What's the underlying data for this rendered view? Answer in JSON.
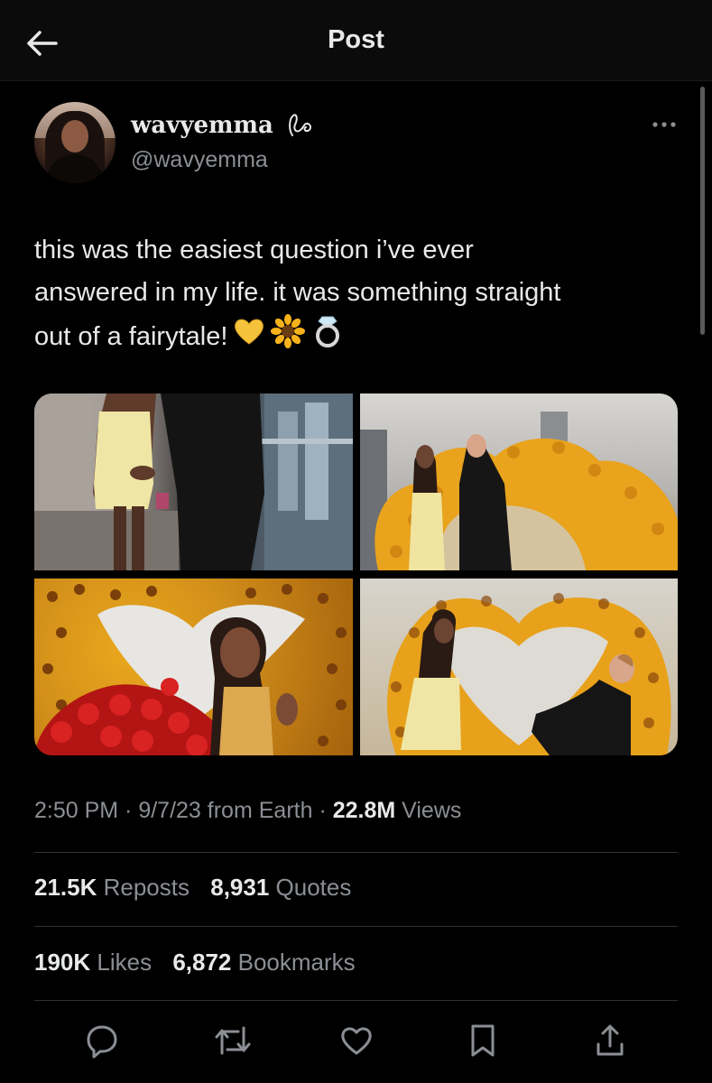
{
  "header": {
    "title": "Post",
    "back_icon": "back-arrow-icon"
  },
  "author": {
    "display_name": "wavyemma",
    "handle": "@wavyemma",
    "name_icon": "cursive-signature-icon"
  },
  "post": {
    "text_lines": [
      "this was the easiest question i’ve ever",
      "answered in my life. it was something straight",
      "out of a fairytale!"
    ],
    "emojis": [
      "yellow-heart",
      "sunflower",
      "ring"
    ],
    "media_count": 4
  },
  "meta": {
    "time": "2:50 PM",
    "sep1": " · ",
    "date": "9/7/23",
    "source": " from Earth",
    "sep2": " · ",
    "views_count": "22.8M",
    "views_label": " Views"
  },
  "stats": {
    "reposts_count": "21.5K",
    "reposts_label": " Reposts",
    "quotes_count": "8,931",
    "quotes_label": " Quotes",
    "likes_count": "190K",
    "likes_label": " Likes",
    "bookmarks_count": "6,872",
    "bookmarks_label": " Bookmarks"
  },
  "actions": [
    "reply-icon",
    "repost-icon",
    "like-icon",
    "bookmark-icon",
    "share-icon"
  ],
  "colors": {
    "background": "#000000",
    "text_primary": "#e7e9ea",
    "text_secondary": "#8b8f94",
    "divider": "#2f3336"
  }
}
